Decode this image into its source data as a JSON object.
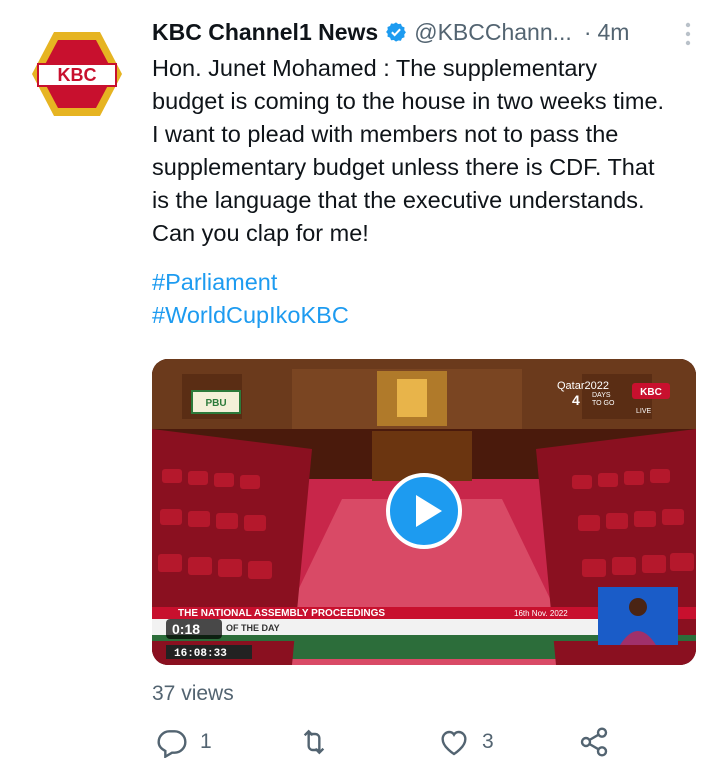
{
  "tweet": {
    "author_name": "KBC Channel1 News",
    "author_handle": "@KBCChann...",
    "time": "4m",
    "separator": "·",
    "avatar_text": "KBC",
    "text": "Hon. Junet Mohamed : The supplementary\nbudget is coming to the house in two weeks time.\nI want to plead with members not to pass the\nsupplementary budget unless there is CDF. That\nis the language that the executive understands.\nCan you clap for me!",
    "hashtags": [
      "#Parliament",
      "#WorldCupIkoKBC"
    ]
  },
  "video": {
    "overlay_title": "THE NATIONAL ASSEMBLY PROCEEDINGS",
    "overlay_date": "16th Nov. 2022",
    "overlay_sub": "OF THE DAY",
    "overlay_clock": "16:08:33",
    "elapsed": "0:18",
    "corner_logo": "KBC",
    "corner_live": "LIVE",
    "countdown_event": "Qatar2022",
    "countdown_days": "4",
    "countdown_label1": "DAYS",
    "countdown_label2": "TO GO",
    "pbu_logo": "PBU"
  },
  "stats": {
    "views": "37 views",
    "replies": "1",
    "likes": "3"
  },
  "colors": {
    "accent": "#1d9bf0",
    "muted": "#536471",
    "kbc_red": "#c8102e",
    "kbc_gold": "#e6b422"
  },
  "icons": [
    "verified-badge-icon",
    "more-options-icon",
    "play-icon",
    "reply-icon",
    "retweet-icon",
    "like-icon",
    "share-icon"
  ]
}
